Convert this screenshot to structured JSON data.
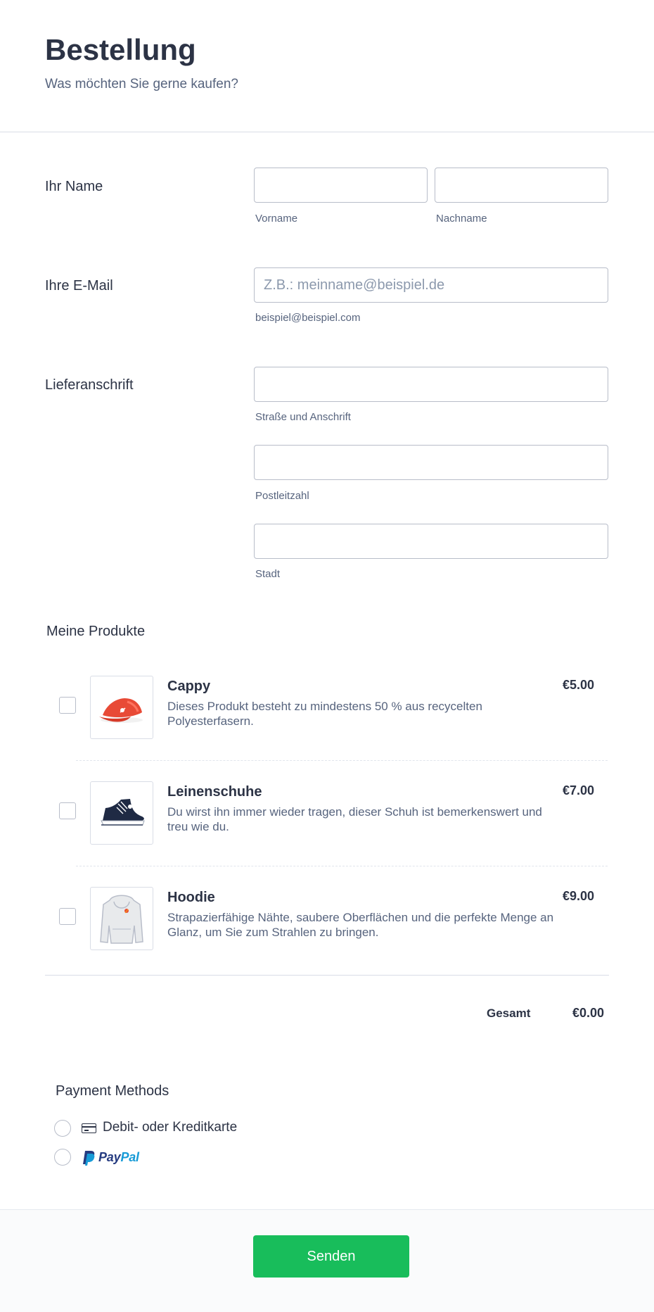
{
  "form": {
    "title": "Bestellung",
    "subtitle": "Was möchten Sie gerne kaufen?"
  },
  "name": {
    "label": "Ihr Name",
    "first_name": {
      "value": "",
      "sublabel": "Vorname"
    },
    "last_name": {
      "value": "",
      "sublabel": "Nachname"
    }
  },
  "email": {
    "label": "Ihre E-Mail",
    "value": "",
    "placeholder": "Z.B.: meinname@beispiel.de",
    "sublabel": "beispiel@beispiel.com"
  },
  "address": {
    "label": "Lieferanschrift",
    "street": {
      "value": "",
      "sublabel": "Straße und Anschrift"
    },
    "postal_code": {
      "value": "",
      "sublabel": "Postleitzahl"
    },
    "city": {
      "value": "",
      "sublabel": "Stadt"
    }
  },
  "products": {
    "title": "Meine Produkte",
    "items": [
      {
        "name": "Cappy",
        "description": "Dieses Produkt besteht zu mindestens 50 % aus recycelten Polyesterfasern.",
        "price": "€5.00",
        "checked": false,
        "image_icon": "red-cap-icon"
      },
      {
        "name": "Leinenschuhe",
        "description": "Du wirst ihn immer wieder tragen, dieser Schuh ist bemerkenswert und treu wie du.",
        "price": "€7.00",
        "checked": false,
        "image_icon": "canvas-shoe-icon"
      },
      {
        "name": "Hoodie",
        "description": "Strapazierfähige Nähte, saubere Oberflächen und die perfekte Menge an Glanz, um Sie zum Strahlen zu bringen.",
        "price": "€9.00",
        "checked": false,
        "image_icon": "hoodie-icon"
      }
    ],
    "total_label": "Gesamt",
    "total_value": "€0.00"
  },
  "payment": {
    "title": "Payment Methods",
    "options": [
      {
        "label": "Debit- oder Kreditkarte",
        "icon": "credit-card-icon",
        "selected": false
      },
      {
        "brand_pay": "Pay",
        "brand_pal": "Pal",
        "icon": "paypal-logo",
        "selected": false
      }
    ]
  },
  "submit": {
    "label": "Senden"
  },
  "colors": {
    "text_primary": "#2c3345",
    "text_secondary": "#57647e",
    "input_border": "#b8bdc9",
    "submit_green": "#18bd5b",
    "paypal_dark_blue": "#253b80",
    "paypal_light_blue": "#179bd7"
  }
}
